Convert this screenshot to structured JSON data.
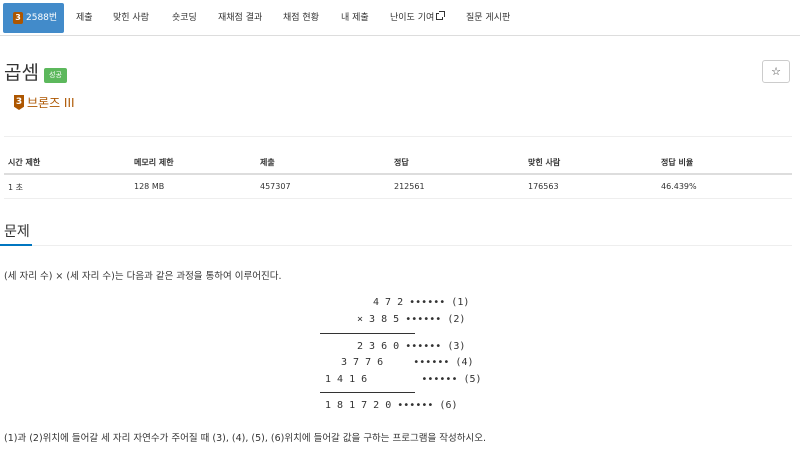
{
  "tabs": {
    "active": {
      "tier": "3",
      "label": "2588번"
    },
    "items": [
      {
        "label": "제출"
      },
      {
        "label": "맞힌 사람"
      },
      {
        "label": "숏코딩"
      },
      {
        "label": "재채점 결과"
      },
      {
        "label": "채점 현황"
      },
      {
        "label": "내 제출"
      },
      {
        "label": "난이도 기여"
      },
      {
        "label": "질문 게시판"
      }
    ]
  },
  "problem": {
    "title": "곱셈",
    "result_badge": "성공",
    "star": "☆",
    "tier_number": "3",
    "tier_label": "브론즈 III"
  },
  "stats": {
    "headers": [
      "시간 제한",
      "메모리 제한",
      "제출",
      "정답",
      "맞힌 사람",
      "정답 비율"
    ],
    "values": [
      "1 초",
      "128 MB",
      "457307",
      "212561",
      "176563",
      "46.439%"
    ]
  },
  "section": {
    "title": "문제"
  },
  "description": {
    "line1": "(세 자리 수) × (세 자리 수)는 다음과 같은 과정을 통하여 이루어진다.",
    "line2": "(1)과 (2)위치에 들어갈 세 자리 자연수가 주어질 때 (3), (4), (5), (6)위치에 들어갈 값을 구하는 프로그램을 작성하시오."
  },
  "figure": {
    "rows": [
      {
        "digits": "4 7 2",
        "marker": "••••••",
        "label": "(1)"
      },
      {
        "digits": "× 3 8 5",
        "marker": "••••••",
        "label": "(2)"
      },
      {
        "digits": "2 3 6 0",
        "marker": "••••••",
        "label": "(3)"
      },
      {
        "digits": "3 7 7 6",
        "marker": "••••••",
        "label": "(4)"
      },
      {
        "digits": "1 4 1 6",
        "marker": "••••••",
        "label": "(5)"
      },
      {
        "digits": "1 8 1 7 2 0",
        "marker": "••••••",
        "label": "(6)"
      }
    ]
  },
  "colors": {
    "active_tab": "#428bca",
    "bronze": "#ad5600",
    "success": "#5cb85c",
    "section_accent": "#0076c0"
  }
}
